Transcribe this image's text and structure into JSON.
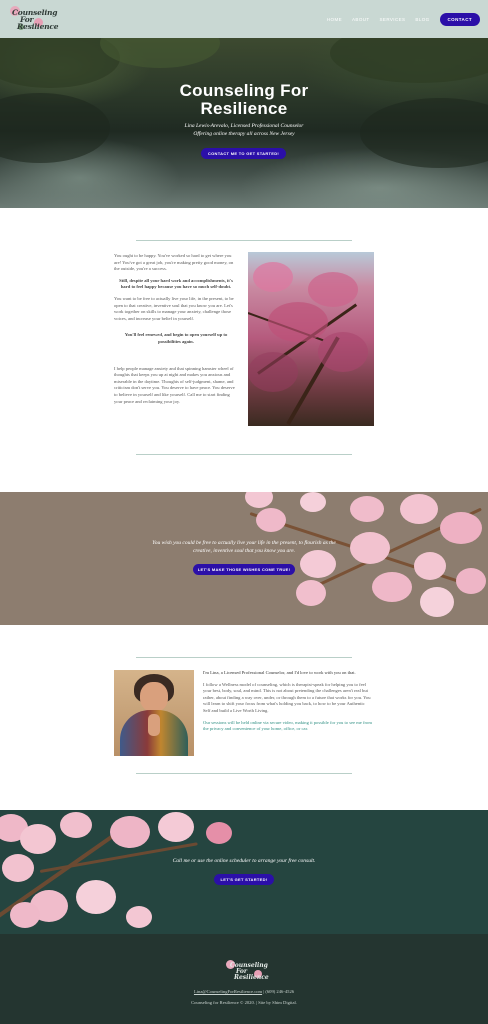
{
  "header": {
    "logo_text_1": "Counseling",
    "logo_text_2": "For",
    "logo_text_3": "Resilience",
    "nav": [
      "HOME",
      "ABOUT",
      "SERVICES",
      "BLOG"
    ],
    "contact_label": "CONTACT"
  },
  "hero": {
    "title_line1": "Counseling For",
    "title_line2": "Resilience",
    "subtitle_line1": "Lina Lewis-Arevalo, Licensed Professional Counselor",
    "subtitle_line2": "Offering online therapy all across New Jersey",
    "cta": "CONTACT ME TO GET STARTED!"
  },
  "intro": {
    "p1": "You ought to be happy. You've worked so hard to get where you are! You've got a great job, you're making pretty good money, on the outside, you're a success.",
    "p2": "Still, despite all your hard work and accomplishments, it's hard to feel happy because you have so much self-doubt.",
    "p3": "You want to be free to actually live your life, in the present, to be open to that creative, inventive soul that you know you are. Let's work together on skills to manage your anxiety, challenge those voices, and increase your belief in yourself.",
    "p4": "You'll feel renewed, and begin to open yourself up to possibilities again.",
    "p5": "I help people manage anxiety and that spinning hamster wheel of thoughts that keeps you up at night and makes you anxious and miserable in the daytime. Thoughts of self-judgment, shame, and criticism don't serve you. You deserve to have peace. You deserve to believe in yourself and like yourself. Call me to start finding your peace and reclaiming your joy."
  },
  "band1": {
    "text_line1": "You wish you could be free to actually live your life in the present, to flourish as the",
    "text_line2": "creative, inventive soul that you know you are.",
    "cta": "LET'S MAKE THOSE WISHES COME TRUE!"
  },
  "about": {
    "lead": "I'm Lina, a Licensed Professional Counselor, and I'd love to work with you on that.",
    "p1": "I follow a Wellness model of counseling, which is therapist-speak for helping you to feel your best, body, soul, and mind. This is not about pretending the challenges aren't real but rather, about finding a way over, under, or through them to a future that works for you. You will learn to shift your focus from what's holding you back, to how to be your Authentic Self and build a Live Worth Living.",
    "p2": "Our sessions will be held online via secure video, making it possible for you to see me from the privacy and convenience of your home, office, or car."
  },
  "band2": {
    "text": "Call me or use the online scheduler to arrange your free consult.",
    "cta": "LET'S GET STARTED!"
  },
  "footer": {
    "email": "Lina@CounselingForResilience.com",
    "separator": " | ",
    "phone": "(609) 246-4526",
    "copyright": "Counseling for Resilience © 2020. | Site by Shim Digital."
  }
}
